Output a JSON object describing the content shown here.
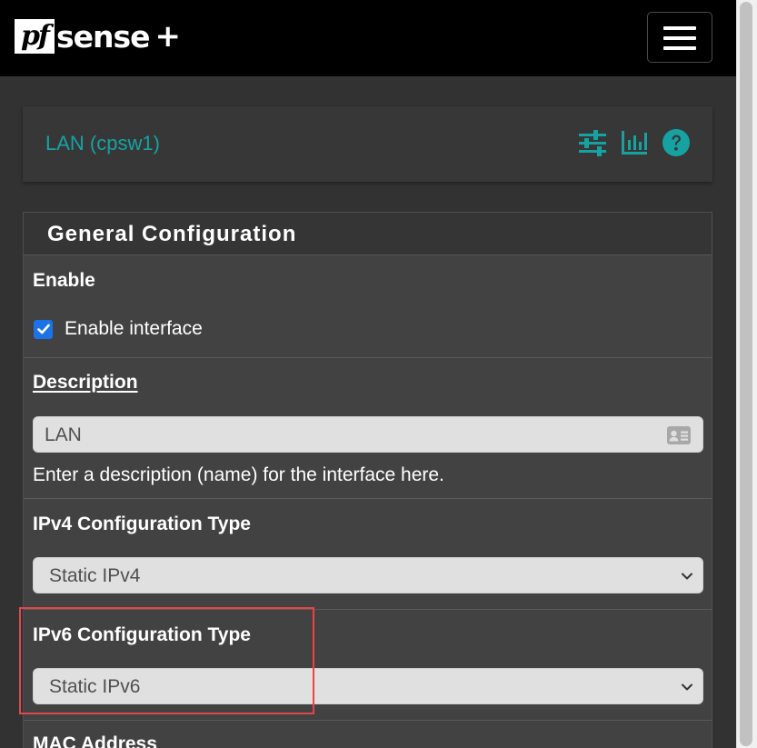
{
  "brand": {
    "logo_pf": "pf",
    "logo_sense": "sense",
    "logo_plus": "+"
  },
  "header": {
    "title": "LAN (cpsw1)",
    "icons": [
      "sliders-icon",
      "bar-chart-icon",
      "help-icon"
    ]
  },
  "panel": {
    "title": "General Configuration",
    "enable": {
      "label": "Enable",
      "checkbox_label": "Enable interface",
      "checked": true
    },
    "description": {
      "label": "Description",
      "value": "LAN",
      "help": "Enter a description (name) for the interface here."
    },
    "ipv4": {
      "label": "IPv4 Configuration Type",
      "selected": "Static IPv4"
    },
    "ipv6": {
      "label": "IPv6 Configuration Type",
      "selected": "Static IPv6"
    },
    "mac": {
      "label": "MAC Address"
    }
  },
  "colors": {
    "accent": "#17a2a2",
    "highlight": "#e0484a",
    "checkbox": "#1a73e8"
  }
}
